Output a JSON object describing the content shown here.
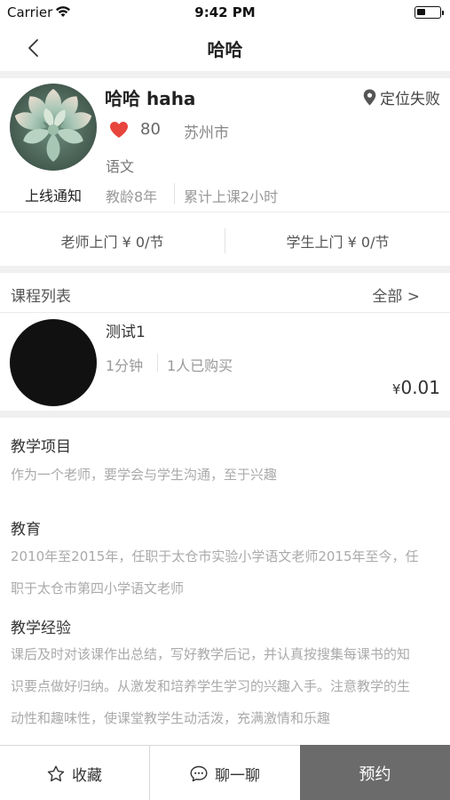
{
  "status_bar": {
    "carrier": "Carrier",
    "time": "9:42 PM"
  },
  "nav": {
    "title": "哈哈",
    "back_icon": "chevron-left-icon"
  },
  "teacher": {
    "name": "哈哈  haha",
    "location": "定位失败",
    "likes": "80",
    "city": "苏州市",
    "subject": "语文",
    "online_notice": "上线通知",
    "teaching_years": "教龄8年",
    "total_hours": "累计上课2小时"
  },
  "prices": {
    "home_visit": "老师上门  ¥ 0/节",
    "student_visit": "学生上门  ¥ 0/节"
  },
  "courses": {
    "header": "课程列表",
    "all_link": "全部 >",
    "items": [
      {
        "name": "测试1",
        "duration": "1分钟",
        "buyers": "1人已购买",
        "currency": "¥",
        "price": "0.01"
      }
    ]
  },
  "sections": {
    "project": {
      "title": "教学项目",
      "lines": [
        "作为一个老师，要学会与学生沟通，至于兴趣"
      ]
    },
    "education": {
      "title": "教育",
      "lines": [
        "2010年至2015年，任职于太仓市实验小学语文老师2015年至今，任",
        "职于太仓市第四小学语文老师"
      ]
    },
    "experience": {
      "title": "教学经验",
      "lines": [
        "课后及时对该课作出总结，写好教学后记，并认真按搜集每课书的知",
        "识要点做好归纳。从激发和培养学生学习的兴趣入手。注意教学的生",
        "动性和趣味性，使课堂教学生动活泼，充满激情和乐趣"
      ]
    }
  },
  "bottom_bar": {
    "favorite_label": "收藏",
    "chat_label": "聊一聊",
    "book_label": "预约"
  },
  "colors": {
    "heart": "#e8453c",
    "book_button_bg": "#6b6b6b"
  }
}
